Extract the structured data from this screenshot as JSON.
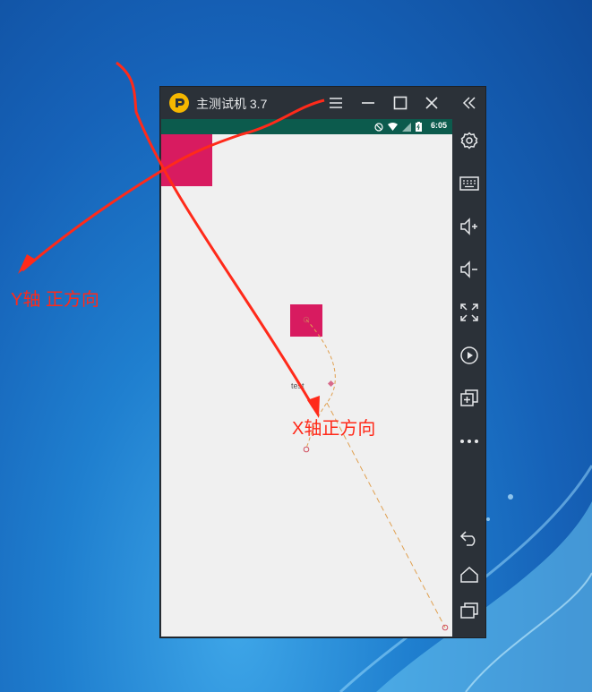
{
  "window": {
    "title": "主测试机 3.7",
    "menu_icon": "menu-icon",
    "minimize_icon": "minimize-icon",
    "maximize_icon": "maximize-icon",
    "close_icon": "close-icon"
  },
  "statusbar": {
    "time": "6:05",
    "icons": [
      "no-sim-icon",
      "wifi-icon",
      "signal-icon",
      "battery-icon"
    ]
  },
  "screen": {
    "test_label": "test"
  },
  "sidebar": {
    "items": [
      {
        "icon": "collapse-icon"
      },
      {
        "icon": "settings-icon"
      },
      {
        "icon": "keyboard-icon"
      },
      {
        "icon": "volume-up-icon"
      },
      {
        "icon": "volume-down-icon"
      },
      {
        "icon": "fullscreen-icon"
      },
      {
        "icon": "record-icon"
      },
      {
        "icon": "multi-window-icon"
      },
      {
        "icon": "more-icon"
      },
      {
        "icon": "back-icon"
      },
      {
        "icon": "home-icon"
      },
      {
        "icon": "recents-icon"
      }
    ]
  },
  "annotations": {
    "y_axis": "Y轴 正方向",
    "x_axis": "X轴正方向"
  },
  "colors": {
    "accent": "#d81b60",
    "statusbar": "#0c5b4d",
    "annotation": "#ff2a1a",
    "path": "#e0a050"
  }
}
